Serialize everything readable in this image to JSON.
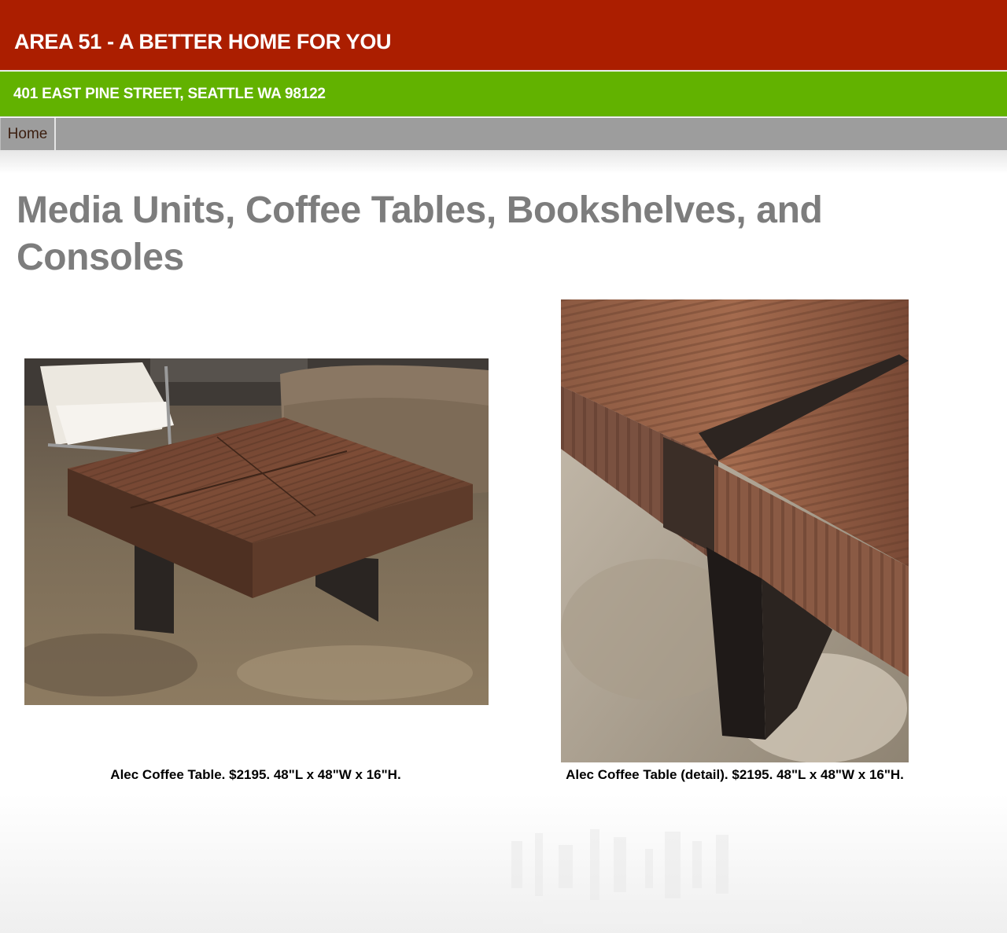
{
  "header": {
    "site_title": "AREA 51 - A BETTER HOME FOR YOU",
    "address": "401 EAST PINE STREET, SEATTLE WA 98122"
  },
  "nav": {
    "items": [
      {
        "label": "Home"
      }
    ]
  },
  "main": {
    "heading": "Media Units, Coffee Tables, Bookshelves, and Consoles",
    "products": [
      {
        "caption": "Alec Coffee Table. $2195. 48\"L x 48\"W x 16\"H."
      },
      {
        "caption": "Alec Coffee Table (detail). $2195. 48\"L x 48\"W x 16\"H."
      }
    ]
  },
  "colors": {
    "header_bg": "#ab1e00",
    "address_bg": "#62b200",
    "nav_bg": "#9d9d9d",
    "heading_text": "#7d7d7d"
  }
}
